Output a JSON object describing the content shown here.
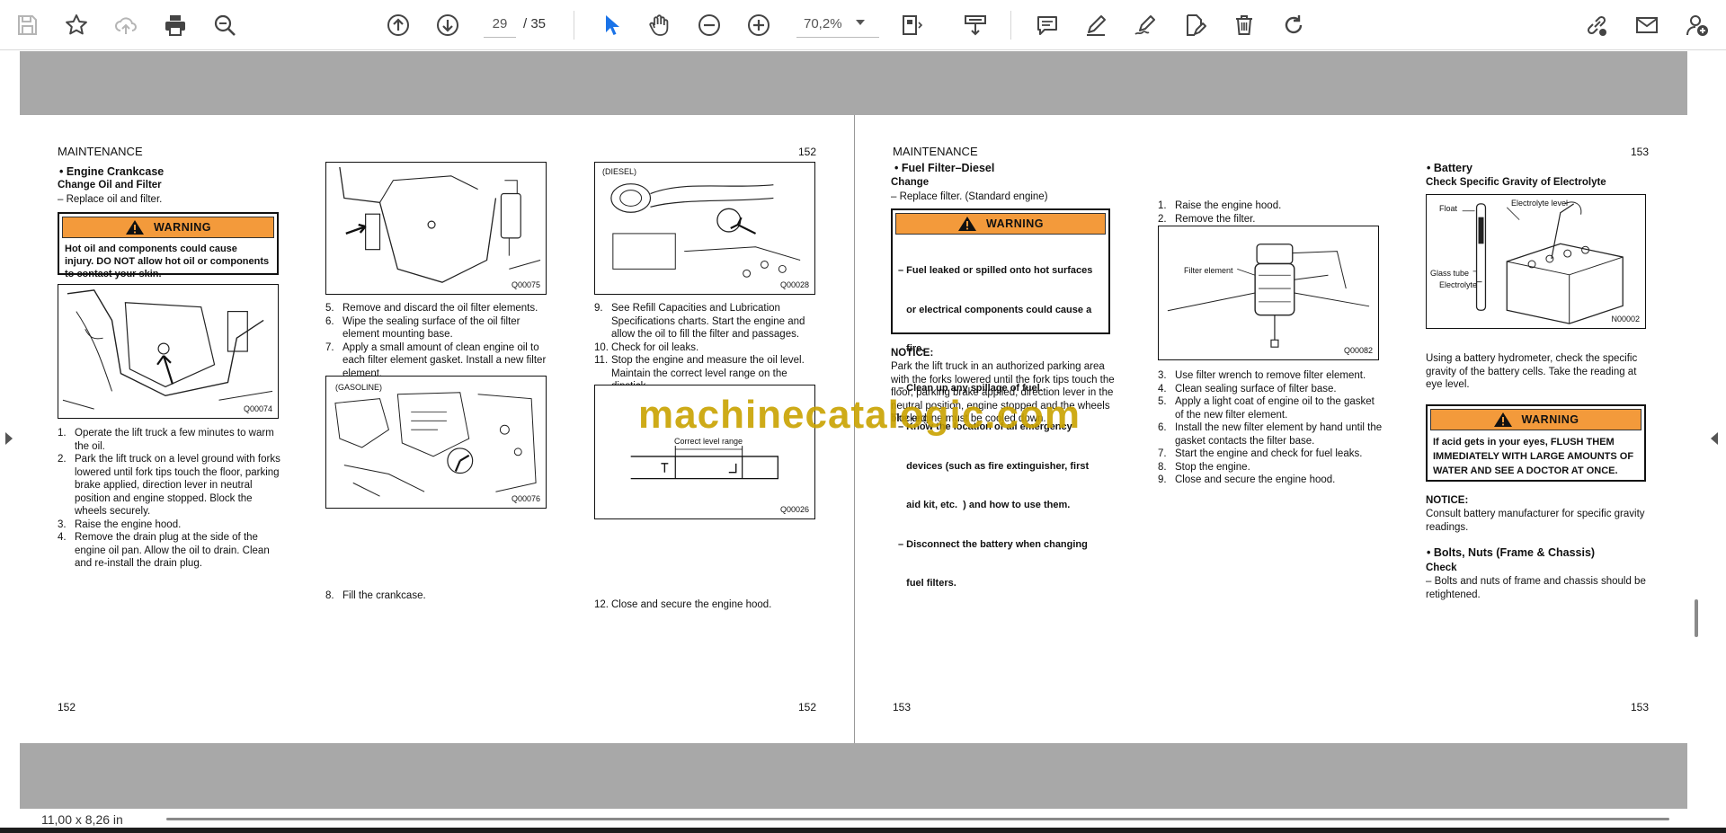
{
  "toolbar": {
    "page_current": "29",
    "page_total": "/ 35",
    "zoom": "70,2%",
    "icons": [
      "save-icon",
      "bookmark-star-icon",
      "upload-cloud-icon",
      "print-icon",
      "zoom-out-search-icon",
      "page-up-icon",
      "page-down-icon",
      "select-cursor-icon",
      "hand-pan-icon",
      "zoom-out-icon",
      "zoom-in-icon",
      "page-fit-icon",
      "scroll-mode-icon",
      "comment-icon",
      "highlight-pen-icon",
      "draw-icon",
      "edit-text-icon",
      "delete-icon",
      "redo-icon",
      "share-link-icon",
      "email-icon",
      "add-user-icon"
    ]
  },
  "status": {
    "page_size": "11,00 x 8,26 in"
  },
  "watermark": "machinecatalogic.com",
  "left_page": {
    "header": "MAINTENANCE",
    "page_top": "152",
    "page_bottom_left": "152",
    "page_bottom_right": "152",
    "section_title": "• Engine Crankcase",
    "section_sub": "Change Oil and Filter",
    "section_note": "– Replace oil and filter.",
    "warning_label": "WARNING",
    "warning_lines": [
      "Hot oil and components could cause",
      "injury. DO NOT allow hot oil or components",
      "to contact your skin."
    ],
    "fig1_code": "Q00074",
    "fig2_code": "Q00075",
    "fig3_label": "(GASOLINE)",
    "fig3_code": "Q00076",
    "fig4_label": "(DIESEL)",
    "fig4_code": "Q00028",
    "fig5_label": "Correct level range",
    "fig5_code": "Q00026",
    "col1_steps": [
      {
        "n": "1.",
        "t": "Operate the lift truck a few minutes to warm the oil."
      },
      {
        "n": "2.",
        "t": "Park the lift truck on a level ground with forks lowered until fork tips touch the floor, parking brake applied, direction lever in neutral position and engine stopped. Block the wheels securely."
      },
      {
        "n": "3.",
        "t": "Raise the engine hood."
      },
      {
        "n": "4.",
        "t": "Remove the drain plug at the side of the engine oil pan. Allow the oil to drain. Clean and re-install the drain plug."
      }
    ],
    "col2_steps": [
      {
        "n": "5.",
        "t": "Remove and discard the oil filter elements."
      },
      {
        "n": "6.",
        "t": "Wipe the sealing surface of the oil filter element mounting base."
      },
      {
        "n": "7.",
        "t": "Apply a small amount of clean engine oil to each filter element gasket.  Install a new filter element."
      }
    ],
    "col2_step8": {
      "n": "8.",
      "t": "Fill the crankcase."
    },
    "col3_steps": [
      {
        "n": "9.",
        "t": "See Refill Capacities and Lubrication Specifications charts. Start the engine and allow the oil to fill the filter and passages."
      },
      {
        "n": "10.",
        "t": "Check for oil leaks."
      },
      {
        "n": "11.",
        "t": "Stop the engine and measure the oil level. Maintain the correct level range on the dipstick."
      }
    ],
    "col3_step12": {
      "n": "12.",
      "t": "Close and secure the engine hood."
    }
  },
  "right_page": {
    "header": "MAINTENANCE",
    "page_top": "153",
    "page_bottom_left": "153",
    "page_bottom_right": "153",
    "fuel_title": "• Fuel Filter–Diesel",
    "fuel_sub": "Change",
    "fuel_note": "– Replace filter. (Standard engine)",
    "warning_label": "WARNING",
    "fuel_warning_lines": [
      "– Fuel leaked or spilled onto hot surfaces",
      "   or electrical components could cause a",
      "   fire.",
      "– Clean up any spillage of fuel.",
      "– Know the location of all emergency",
      "   devices (such as fire extinguisher, first",
      "   aid kit, etc.  ) and how to use them.",
      "– Disconnect the battery when changing",
      "   fuel filters."
    ],
    "notice_label": "NOTICE:",
    "notice_text": "Park the lift truck in an authorized parking area with the forks lowered until the fork tips touch the floor, parking brake applied, direction lever in the neutral position, engine stopped and the wheels blocked.",
    "notice_text2": "The engine must be cooled down.",
    "fuel_steps_a": [
      {
        "n": "1.",
        "t": "Raise the engine hood."
      },
      {
        "n": "2.",
        "t": "Remove the filter."
      }
    ],
    "fig_filter_label": "Filter element",
    "fig_filter_code": "Q00082",
    "fuel_steps_b": [
      {
        "n": "3.",
        "t": "Use filter wrench to remove filter element."
      },
      {
        "n": "4.",
        "t": "Clean sealing surface of filter base."
      },
      {
        "n": "5.",
        "t": "Apply a light coat of engine oil to the gasket of the new filter element."
      },
      {
        "n": "6.",
        "t": "Install the new filter element by hand until the gasket contacts the filter base."
      },
      {
        "n": "7.",
        "t": "Start the engine and check for fuel leaks."
      },
      {
        "n": "8.",
        "t": "Stop the engine."
      },
      {
        "n": "9.",
        "t": "Close and secure the engine hood."
      }
    ],
    "battery_title": "• Battery",
    "battery_sub": "Check Specific Gravity of Electrolyte",
    "fig_batt_float": "Float",
    "fig_batt_level": "Electrolyte level",
    "fig_batt_glass": "Glass tube",
    "fig_batt_electrolyte": "Electrolyte",
    "fig_batt_code": "N00002",
    "battery_text": "Using a battery hydrometer, check the specific gravity of the battery cells. Take the reading at eye level.",
    "acid_warning_lines": [
      "If acid gets in your eyes, FLUSH THEM",
      "IMMEDIATELY WITH LARGE AMOUNTS OF",
      "WATER AND SEE A DOCTOR AT ONCE."
    ],
    "battery_notice_label": "NOTICE:",
    "battery_notice_text": "Consult battery manufacturer for specific gravity readings.",
    "bolts_title": "• Bolts, Nuts (Frame & Chassis)",
    "bolts_sub": "Check",
    "bolts_note": "– Bolts and nuts of frame and chassis should be retightened."
  }
}
